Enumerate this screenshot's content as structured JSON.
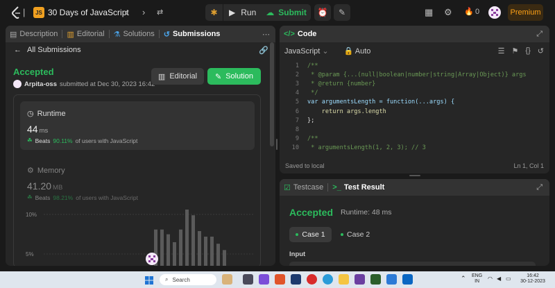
{
  "topbar": {
    "title": "30 Days of JavaScript",
    "run_label": "Run",
    "submit_label": "Submit",
    "streak_count": "0",
    "premium_label": "Premium",
    "js_badge": "JS"
  },
  "left_panel": {
    "tabs": [
      "Description",
      "Editorial",
      "Solutions",
      "Submissions"
    ],
    "back_label": "All Submissions",
    "status": "Accepted",
    "username": "Arpita-oss",
    "submitted_text": "submitted at Dec 30, 2023 16:42",
    "editorial_btn": "Editorial",
    "solution_btn": "Solution",
    "runtime": {
      "label": "Runtime",
      "value": "44",
      "unit": "ms",
      "beats_prefix": "Beats",
      "beats_pct": "90.11%",
      "beats_suffix": "of users with JavaScript"
    },
    "memory": {
      "label": "Memory",
      "value": "41.20",
      "unit": "MB",
      "beats_prefix": "Beats",
      "beats_pct": "98.21%",
      "beats_suffix": "of users with JavaScript"
    },
    "chart_ticks": [
      "10%",
      "5%"
    ]
  },
  "chart_data": {
    "type": "bar",
    "ylim": [
      0,
      12
    ],
    "yticks": [
      "10%",
      "5%"
    ],
    "values": [
      5.2,
      5.2,
      4.6,
      3.6,
      5.2,
      8.0,
      7.0,
      5.0,
      4.3,
      4.3,
      3.4,
      2.6
    ]
  },
  "code_panel": {
    "title": "Code",
    "language": "JavaScript",
    "mode": "Auto",
    "footer_left": "Saved to local",
    "footer_right": "Ln 1, Col 1",
    "line_numbers": [
      "1",
      "2",
      "3",
      "4",
      "5",
      "6",
      "7",
      "8",
      "9",
      "10"
    ],
    "lines": [
      "/**",
      " * @param {...(null|boolean|number|string|Array|Object)} args",
      " * @return {number}",
      " */",
      "var argumentsLength = function(...args) {",
      "    return args.length",
      "};",
      "",
      "/**",
      " * argumentsLength(1, 2, 3); // 3"
    ]
  },
  "result_panel": {
    "tabs": [
      "Testcase",
      "Test Result"
    ],
    "status": "Accepted",
    "runtime_text": "Runtime: 48 ms",
    "cases": [
      "Case 1",
      "Case 2"
    ],
    "input_label": "Input"
  },
  "taskbar": {
    "search_placeholder": "Search",
    "lang1": "ENG",
    "lang2": "IN",
    "time": "16:42",
    "date": "30-12-2023"
  }
}
